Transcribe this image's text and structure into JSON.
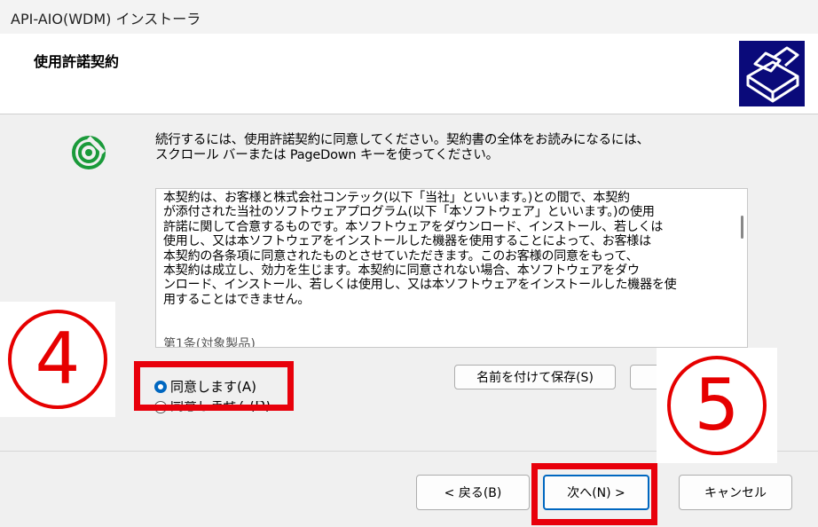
{
  "window": {
    "title": "API-AIO(WDM) インストーラ"
  },
  "header": {
    "title": "使用許諾契約",
    "icon": "installer-box-icon"
  },
  "intro": {
    "line1": "続行するには、使用許諾契約に同意してください。契約書の全体をお読みになるには、",
    "line2": "スクロール バーまたは PageDown キーを使ってください。"
  },
  "license": {
    "lines": [
      "本契約は、お客様と株式会社コンテック(以下「当社」といいます。)との間で、本契約",
      "が添付された当社のソフトウェアプログラム(以下「本ソフトウェア」といいます。)の使用",
      "許諾に関して合意するものです。本ソフトウェアをダウンロード、インストール、若しくは",
      "使用し、又は本ソフトウェアをインストールした機器を使用することによって、お客様は",
      "本契約の各条項に同意されたものとさせていただきます。このお客様の同意をもって、",
      "本契約は成立し、効力を生じます。本契約に同意されない場合、本ソフトウェアをダウ",
      "ンロード、インストール、若しくは使用し、又は本ソフトウェアをインストールした機器を使",
      "用することはできません。"
    ],
    "truncated_line": "第1条(対象製品)"
  },
  "options": {
    "agree_label": "同意します(A)",
    "disagree_label": "同意しません(D)",
    "selected": "agree"
  },
  "buttons": {
    "save": "名前を付けて保存(S)",
    "back": "< 戻る(B)",
    "next": "次へ(N) >",
    "cancel": "キャンセル"
  },
  "annotations": {
    "step4": "4",
    "step5": "5",
    "highlight_color": "#e60000"
  }
}
